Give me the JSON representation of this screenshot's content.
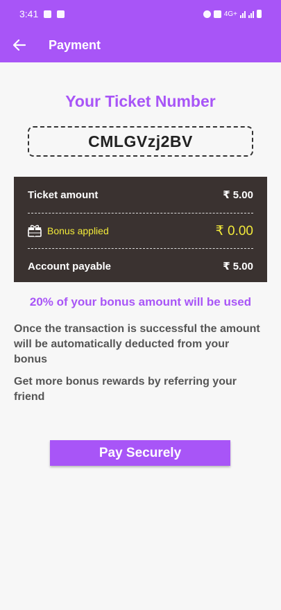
{
  "status_bar": {
    "time": "3:41",
    "network_label": "4G+"
  },
  "app_bar": {
    "title": "Payment",
    "back_icon": "arrow-left-icon"
  },
  "ticket": {
    "heading": "Your Ticket Number",
    "number": "CMLGVzj2BV"
  },
  "summary": {
    "ticket_amount_label": "Ticket amount",
    "ticket_amount_value": "₹ 5.00",
    "bonus_label": "Bonus applied",
    "bonus_value": "₹ 0.00",
    "bonus_icon": "gift-icon",
    "payable_label": "Account payable",
    "payable_value": "₹ 5.00"
  },
  "bonus_note": "20% of your bonus amount will be used",
  "info": {
    "transaction_text": "Once the transaction is successful the amount will be automatically deducted from your bonus",
    "referral_text": "Get more bonus rewards by referring your friend"
  },
  "pay_button_label": "Pay Securely",
  "colors": {
    "accent": "#a855f7",
    "summary_bg": "#3a3230",
    "bonus_text": "#f2ea3a"
  }
}
